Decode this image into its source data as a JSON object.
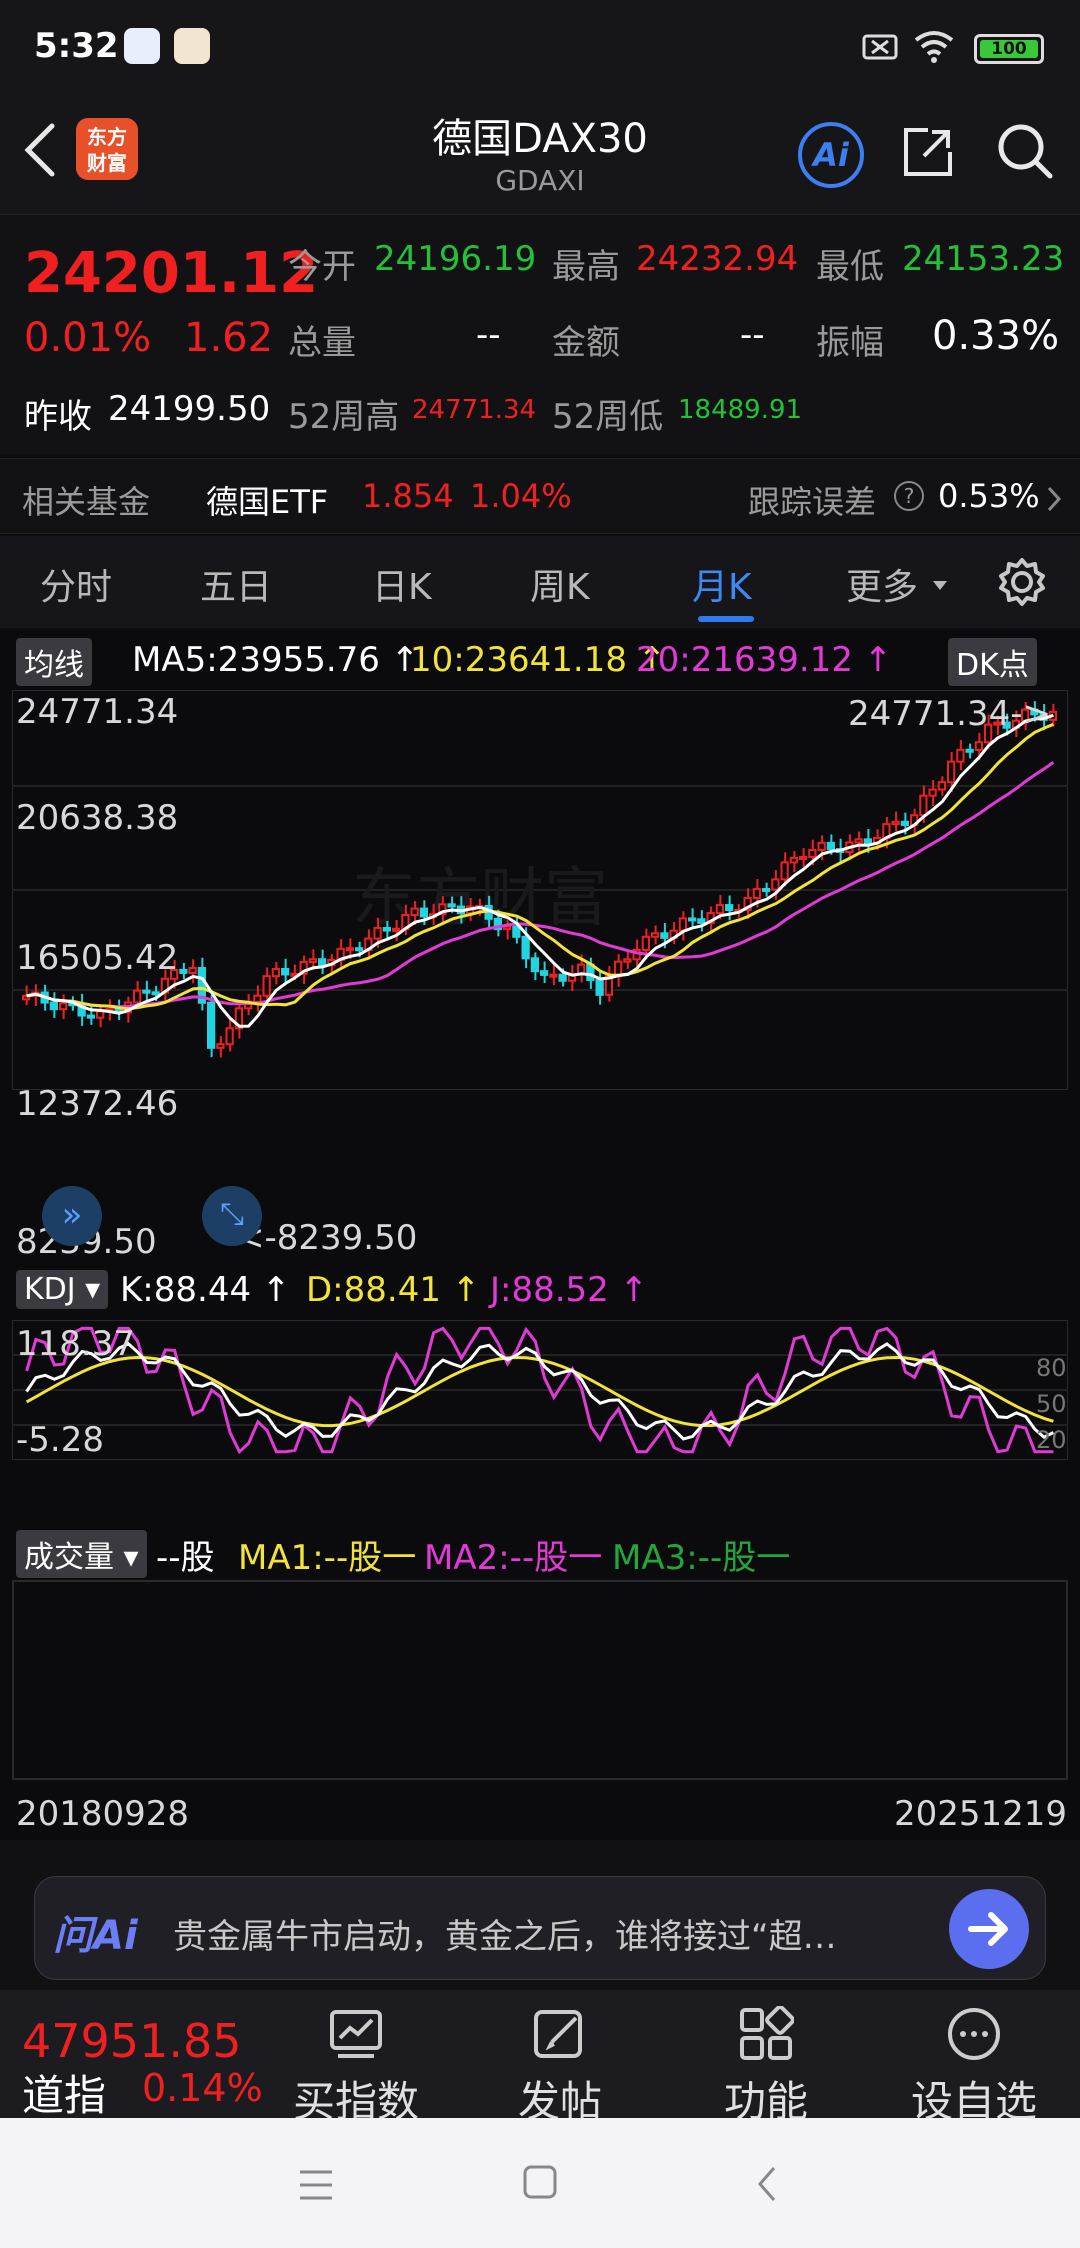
{
  "status_bar": {
    "time": "5:32",
    "battery": "100"
  },
  "header": {
    "title": "德国DAX30",
    "subtitle": "GDAXI",
    "logo_text_1": "东方",
    "logo_text_2": "财富",
    "ai_label": "Ai"
  },
  "quote": {
    "price": "24201.12",
    "change_pct": "0.01%",
    "change_abs": "1.62",
    "open_label": "今开",
    "open": "24196.19",
    "high_label": "最高",
    "high": "24232.94",
    "low_label": "最低",
    "low": "24153.23",
    "volume_label": "总量",
    "volume": "--",
    "amount_label": "金额",
    "amount": "--",
    "amplitude_label": "振幅",
    "amplitude": "0.33%",
    "prev_close_label": "昨收",
    "prev_close": "24199.50",
    "w52_high_label": "52周高",
    "w52_high": "24771.34",
    "w52_low_label": "52周低",
    "w52_low": "18489.91"
  },
  "fund": {
    "label": "相关基金",
    "name": "德国ETF",
    "price": "1.854",
    "change": "1.04%",
    "tracking_label": "跟踪误差",
    "tracking_value": "0.53%"
  },
  "tabs": [
    {
      "label": "分时"
    },
    {
      "label": "五日"
    },
    {
      "label": "日K"
    },
    {
      "label": "周K"
    },
    {
      "label": "月K"
    },
    {
      "label": "更多"
    }
  ],
  "active_tab": "月K",
  "main_chart": {
    "indicator_tag": "均线",
    "ma5": "MA5:23955.76",
    "ma10": "10:23641.18",
    "ma20": "20:21639.12",
    "dk_button": "DK点",
    "y_ticks": [
      "24771.34",
      "20638.38",
      "16505.42",
      "12372.46",
      "8239.50"
    ],
    "max_marker": "24771.34->",
    "min_marker": "<-8239.50",
    "watermark": "东方财富"
  },
  "kdj": {
    "tag": "KDJ",
    "k": "K:88.44",
    "d": "D:88.41",
    "j": "J:88.52",
    "y_max": "118.37",
    "y_min": "-5.28",
    "ref_levels": [
      "80",
      "50",
      "20"
    ]
  },
  "volume": {
    "tag": "成交量",
    "value": "--股",
    "ma1": "MA1:--股",
    "ma2": "MA2:--股",
    "ma3": "MA3:--股"
  },
  "date_range": {
    "start": "20180928",
    "end": "20251219"
  },
  "ai_bar": {
    "brand": "问Ai",
    "prompt": "贵金属牛市启动，黄金之后，谁将接过“超…"
  },
  "toolbar": {
    "ticker_price": "47951.85",
    "ticker_name": "道指",
    "ticker_change": "0.14%",
    "items": [
      {
        "label": "买指数"
      },
      {
        "label": "发帖"
      },
      {
        "label": "功能"
      },
      {
        "label": "设自选"
      }
    ]
  },
  "colors": {
    "up": "#f02020",
    "down": "#22d3e0",
    "ma5": "#ffffff",
    "ma10": "#f2e33b",
    "ma20": "#e13ad6",
    "accent": "#2e7bf0"
  }
}
